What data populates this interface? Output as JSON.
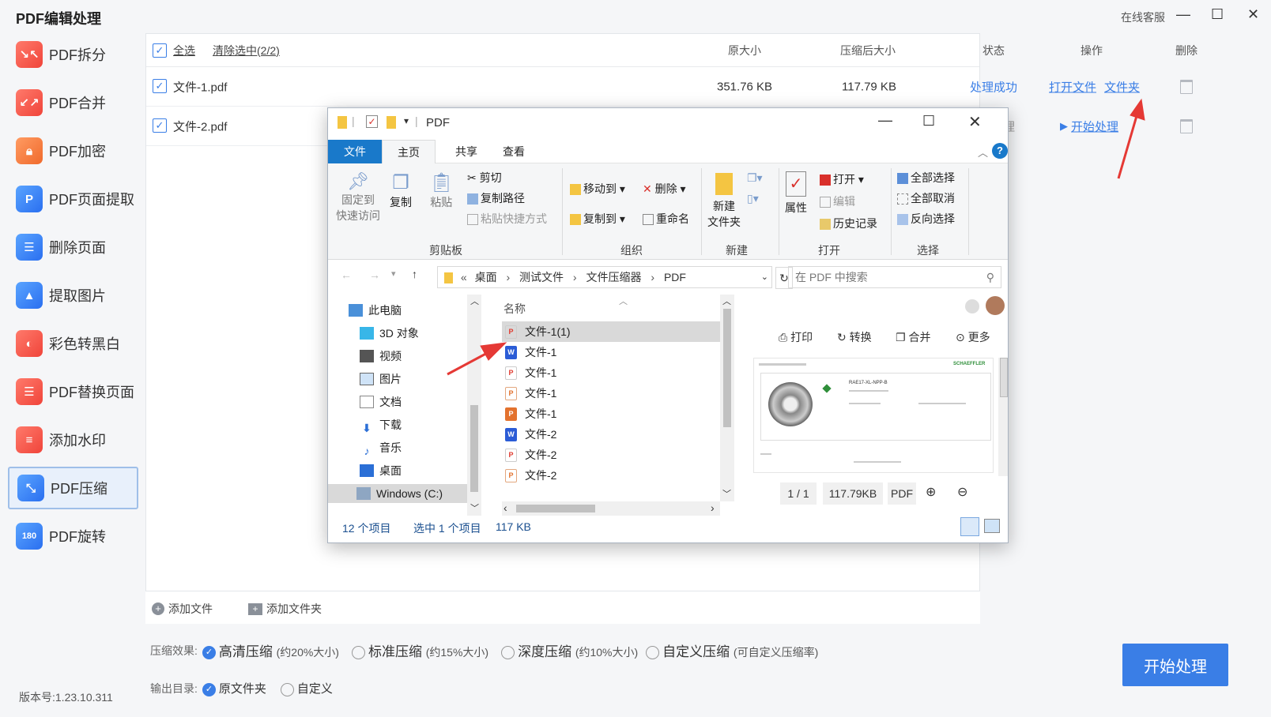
{
  "app": {
    "title": "PDF编辑处理",
    "service": "在线客服",
    "minimize": "—",
    "maximize": "☐",
    "close": "✕",
    "version": "版本号:1.23.10.311"
  },
  "sidebar": {
    "items": [
      {
        "label": "PDF拆分",
        "icon": "split-icon"
      },
      {
        "label": "PDF合并",
        "icon": "merge-icon"
      },
      {
        "label": "PDF加密",
        "icon": "lock-icon"
      },
      {
        "label": "PDF页面提取",
        "icon": "page-extract-icon"
      },
      {
        "label": "删除页面",
        "icon": "delete-page-icon"
      },
      {
        "label": "提取图片",
        "icon": "extract-image-icon"
      },
      {
        "label": "彩色转黑白",
        "icon": "palette-icon"
      },
      {
        "label": "PDF替换页面",
        "icon": "replace-page-icon"
      },
      {
        "label": "添加水印",
        "icon": "watermark-icon"
      },
      {
        "label": "PDF压缩",
        "icon": "compress-icon"
      },
      {
        "label": "PDF旋转",
        "icon": "rotate-icon"
      }
    ],
    "active_index": 9
  },
  "table": {
    "select_all": "全选",
    "clear_selection": "清除选中(2/2)",
    "headers": {
      "original_size": "原大小",
      "compressed_size": "压缩后大小",
      "status": "状态",
      "action": "操作",
      "delete": "删除"
    },
    "rows": [
      {
        "name": "文件-1.pdf",
        "original_size": "351.76 KB",
        "compressed_size": "117.79 KB",
        "status": "处理成功",
        "action_open": "打开文件",
        "action_folder": "文件夹"
      },
      {
        "name": "文件-2.pdf",
        "status_partial": "理",
        "action_start": "开始处理"
      }
    ]
  },
  "footer": {
    "add_file": "添加文件",
    "add_folder": "添加文件夹"
  },
  "options": {
    "compress_label": "压缩效果:",
    "modes": [
      {
        "label": "高清压缩",
        "note": "(约20%大小)",
        "checked": true
      },
      {
        "label": "标准压缩",
        "note": "(约15%大小)",
        "checked": false
      },
      {
        "label": "深度压缩",
        "note": "(约10%大小)",
        "checked": false
      },
      {
        "label": "自定义压缩",
        "note": "(可自定义压缩率)",
        "checked": false
      }
    ],
    "output_label": "输出目录:",
    "outputs": [
      {
        "label": "原文件夹",
        "checked": true
      },
      {
        "label": "自定义",
        "checked": false
      }
    ],
    "start_button": "开始处理"
  },
  "explorer": {
    "title": "PDF",
    "tabs": [
      "文件",
      "主页",
      "共享",
      "查看"
    ],
    "ribbon": {
      "pin": "固定到",
      "pin2": "快速访问",
      "copy": "复制",
      "paste": "粘贴",
      "cut": "剪切",
      "copy_path": "复制路径",
      "paste_shortcut": "粘贴快捷方式",
      "clipboard": "剪贴板",
      "move_to": "移动到",
      "copy_to": "复制到",
      "delete": "删除",
      "rename": "重命名",
      "organize": "组织",
      "new_folder": "新建",
      "new_folder2": "文件夹",
      "new": "新建",
      "properties": "属性",
      "open": "打开",
      "edit": "编辑",
      "history": "历史记录",
      "open_group": "打开",
      "select_all": "全部选择",
      "select_none": "全部取消",
      "invert": "反向选择",
      "select_group": "选择"
    },
    "path": [
      "桌面",
      "测试文件",
      "文件压缩器",
      "PDF"
    ],
    "search_placeholder": "在 PDF 中搜索",
    "nav": [
      "此电脑",
      "3D 对象",
      "视频",
      "图片",
      "文档",
      "下载",
      "音乐",
      "桌面",
      "Windows (C:)"
    ],
    "column_name": "名称",
    "files": [
      {
        "name": "文件-1(1)",
        "type": "pdf"
      },
      {
        "name": "文件-1",
        "type": "word"
      },
      {
        "name": "文件-1",
        "type": "pdf"
      },
      {
        "name": "文件-1",
        "type": "ppt"
      },
      {
        "name": "文件-1",
        "type": "pptf"
      },
      {
        "name": "文件-2",
        "type": "word"
      },
      {
        "name": "文件-2",
        "type": "pdf"
      },
      {
        "name": "文件-2",
        "type": "ppt"
      }
    ],
    "preview": {
      "print": "打印",
      "convert": "转换",
      "merge": "合并",
      "more": "更多",
      "page": "1 / 1",
      "size": "117.79KB",
      "format": "PDF",
      "doc_brand": "SCHAEFFLER",
      "doc_code": "RAE17-XL-NPP-B"
    },
    "status": {
      "count": "12 个项目",
      "selected": "选中 1 个项目",
      "size": "117 KB"
    }
  }
}
